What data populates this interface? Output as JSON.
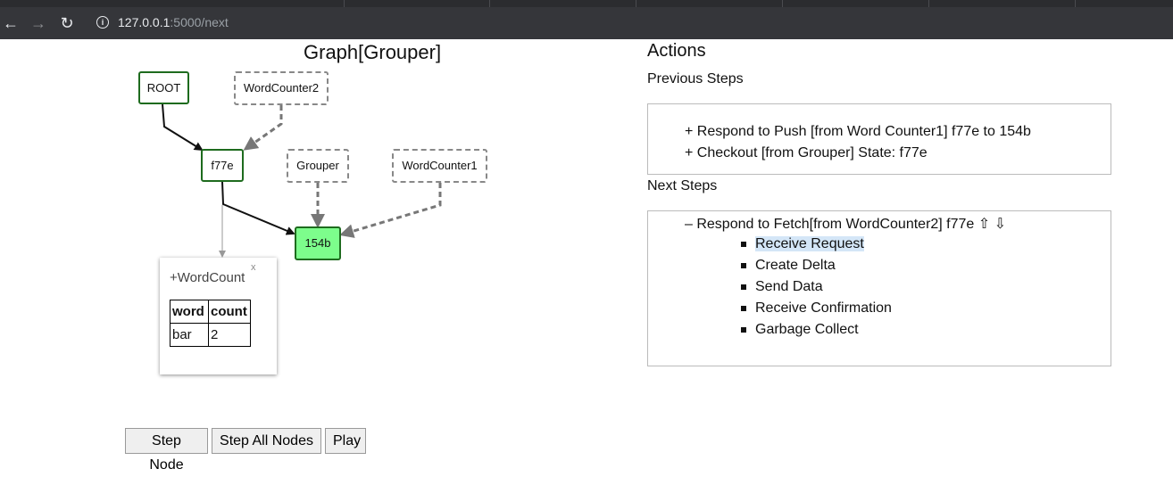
{
  "browser": {
    "url_host": "127.0.0.1",
    "url_path": ":5000/next",
    "info_icon": "info-icon",
    "back_icon": "←",
    "forward_icon": "→",
    "reload_icon": "↻"
  },
  "graph": {
    "title": "Graph[Grouper]",
    "nodes": {
      "root": "ROOT",
      "wordcounter2": "WordCounter2",
      "f77e": "f77e",
      "grouper": "Grouper",
      "wordcounter1": "WordCounter1",
      "n154b": "154b"
    },
    "popup": {
      "title": "+WordCount",
      "close": "x",
      "headers": [
        "word",
        "count"
      ],
      "rows": [
        [
          "bar",
          "2"
        ]
      ]
    }
  },
  "controls": {
    "step_node": "Step Node",
    "step_all": "Step All Nodes",
    "play": "Play"
  },
  "actions": {
    "title": "Actions",
    "previous_label": "Previous Steps",
    "previous": [
      "+ Respond to Push [from Word Counter1] f77e to 154b",
      "+ Checkout [from Grouper] State: f77e"
    ],
    "next_label": "Next Steps",
    "next_header": "– Respond to Fetch[from WordCounter2] f77e",
    "next_arrows": "⇧ ⇩",
    "next_items": [
      "Receive Request",
      "Create Delta",
      "Send Data",
      "Receive Confirmation",
      "Garbage Collect"
    ]
  }
}
